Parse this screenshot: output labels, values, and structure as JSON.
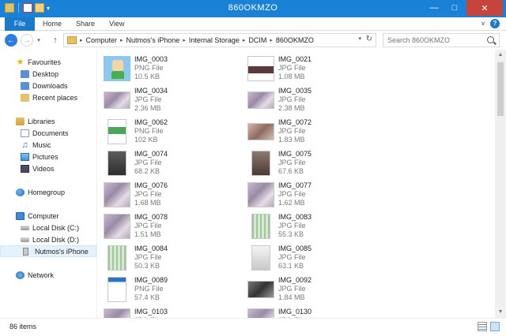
{
  "window": {
    "title": "860OKMZO"
  },
  "ribbon": {
    "tabs": [
      "File",
      "Home",
      "Share",
      "View"
    ]
  },
  "address": {
    "crumbs": [
      "Computer",
      "Nutmos's iPhone",
      "Internal Storage",
      "DCIM",
      "860OKMZO"
    ],
    "search_placeholder": "Search 860OKMZO"
  },
  "sidebar": {
    "favourites": "Favourites",
    "desktop": "Desktop",
    "downloads": "Downloads",
    "recent": "Recent places",
    "libraries": "Libraries",
    "documents": "Documents",
    "music": "Music",
    "pictures": "Pictures",
    "videos": "Videos",
    "homegroup": "Homegroup",
    "computer": "Computer",
    "disk_c": "Local Disk (C:)",
    "disk_d": "Local Disk (D:)",
    "iphone": "Nutmos's iPhone",
    "network": "Network"
  },
  "files": [
    {
      "name": "IMG_0003",
      "type": "PNG File",
      "size": "10.5 KB",
      "thumb": "avatar"
    },
    {
      "name": "IMG_0021",
      "type": "JPG File",
      "size": "1.08 MB",
      "thumb": "png"
    },
    {
      "name": "IMG_0034",
      "type": "JPG File",
      "size": "2.36 MB",
      "thumb": "jpg wide"
    },
    {
      "name": "IMG_0035",
      "type": "JPG File",
      "size": "2.38 MB",
      "thumb": "jpg wide"
    },
    {
      "name": "IMG_0062",
      "type": "PNG File",
      "size": "102 KB",
      "thumb": "png"
    },
    {
      "name": "IMG_0072",
      "type": "JPG File",
      "size": "1.83 MB",
      "thumb": "jpg wide"
    },
    {
      "name": "IMG_0074",
      "type": "JPG File",
      "size": "68.2 KB",
      "thumb": "dark"
    },
    {
      "name": "IMG_0075",
      "type": "JPG File",
      "size": "67.6 KB",
      "thumb": "dark"
    },
    {
      "name": "IMG_0076",
      "type": "JPG File",
      "size": "1.68 MB",
      "thumb": "jpg"
    },
    {
      "name": "IMG_0077",
      "type": "JPG File",
      "size": "1.62 MB",
      "thumb": "jpg"
    },
    {
      "name": "IMG_0078",
      "type": "JPG File",
      "size": "1.51 MB",
      "thumb": "jpg"
    },
    {
      "name": "IMG_0083",
      "type": "JPG File",
      "size": "55.3 KB",
      "thumb": "grid"
    },
    {
      "name": "IMG_0084",
      "type": "JPG File",
      "size": "50.3 KB",
      "thumb": "grid"
    },
    {
      "name": "IMG_0085",
      "type": "JPG File",
      "size": "63.1 KB",
      "thumb": "png"
    },
    {
      "name": "IMG_0089",
      "type": "PNG File",
      "size": "57.4 KB",
      "thumb": "png"
    },
    {
      "name": "IMG_0092",
      "type": "JPG File",
      "size": "1.84 MB",
      "thumb": "jpg wide"
    },
    {
      "name": "IMG_0103",
      "type": "JPG File",
      "size": "",
      "thumb": "jpg"
    },
    {
      "name": "IMG_0130",
      "type": "JPG File",
      "size": "",
      "thumb": "jpg"
    }
  ],
  "status": {
    "count": "86 items"
  }
}
